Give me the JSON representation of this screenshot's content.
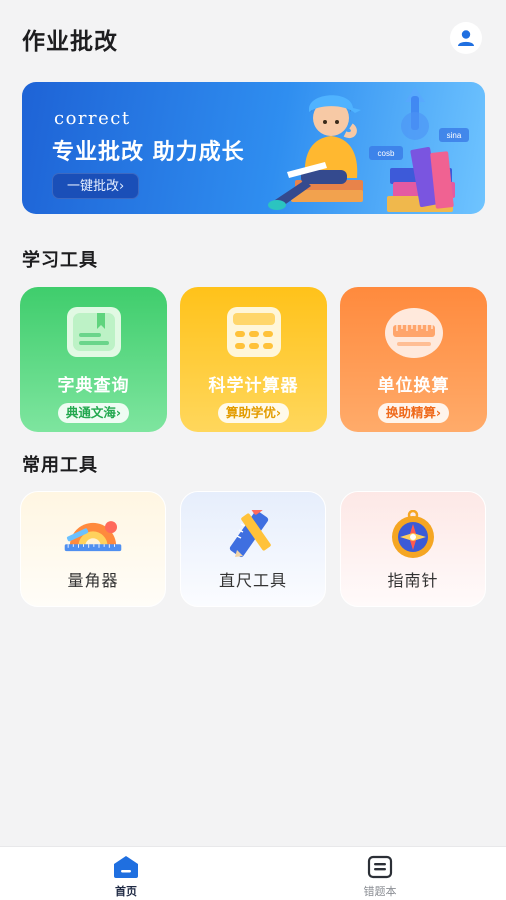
{
  "header": {
    "title": "作业批改",
    "user_icon": "user-icon"
  },
  "banner": {
    "en_title": "correct",
    "slogan": "专业批改 助力成长",
    "button_label": "一键批改",
    "button_icon": "chevron-right-icon",
    "art_words": [
      "cosb",
      "sina"
    ]
  },
  "study_tools": {
    "title": "学习工具",
    "items": [
      {
        "name": "字典查询",
        "sub": "典通文海",
        "icon": "dictionary-icon",
        "color": "#3fcd6c"
      },
      {
        "name": "科学计算器",
        "sub": "算助学优",
        "icon": "calculator-icon",
        "color": "#ffc21a"
      },
      {
        "name": "单位换算",
        "sub": "换助精算",
        "icon": "ruler-icon",
        "color": "#ff8a3d"
      }
    ]
  },
  "common_tools": {
    "title": "常用工具",
    "items": [
      {
        "name": "量角器",
        "icon": "protractor-icon"
      },
      {
        "name": "直尺工具",
        "icon": "ruler-pencil-icon"
      },
      {
        "name": "指南针",
        "icon": "compass-icon"
      }
    ]
  },
  "tabbar": {
    "items": [
      {
        "label": "首页",
        "icon": "home-icon",
        "active": true
      },
      {
        "label": "错题本",
        "icon": "wrong-book-icon",
        "active": false
      }
    ]
  },
  "colors": {
    "accent": "#1f6fe0",
    "background": "#f3f3f4"
  }
}
